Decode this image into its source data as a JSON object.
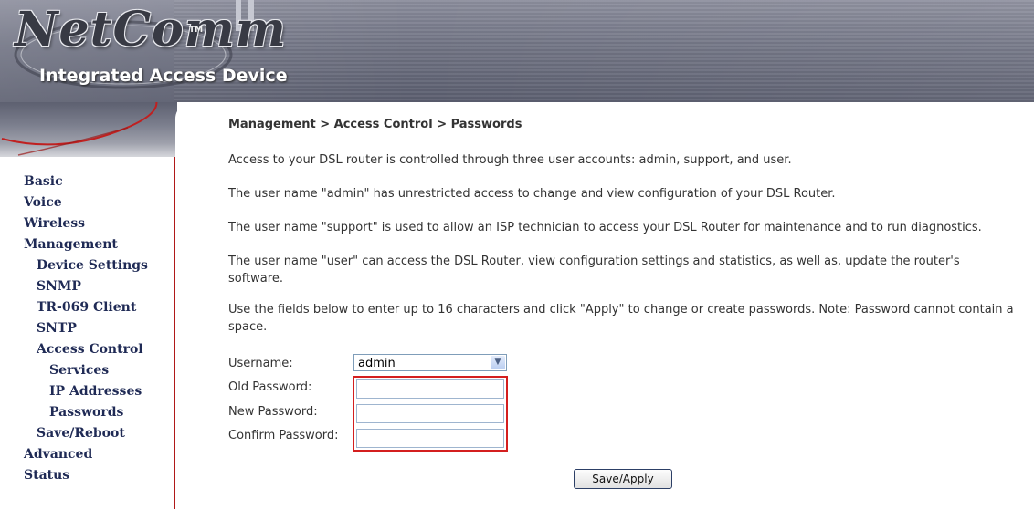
{
  "banner": {
    "logo_text": "NetComm",
    "trademark": "TM",
    "product_name": "Integrated Access Device"
  },
  "nav": [
    {
      "label": "Basic",
      "level": 1
    },
    {
      "label": "Voice",
      "level": 1
    },
    {
      "label": "Wireless",
      "level": 1
    },
    {
      "label": "Management",
      "level": 1
    },
    {
      "label": "Device Settings",
      "level": 2
    },
    {
      "label": "SNMP",
      "level": 2
    },
    {
      "label": "TR-069 Client",
      "level": 2
    },
    {
      "label": "SNTP",
      "level": 2
    },
    {
      "label": "Access Control",
      "level": 2
    },
    {
      "label": "Services",
      "level": 3
    },
    {
      "label": "IP Addresses",
      "level": 3
    },
    {
      "label": "Passwords",
      "level": 3
    },
    {
      "label": "Save/Reboot",
      "level": 2
    },
    {
      "label": "Advanced",
      "level": 1
    },
    {
      "label": "Status",
      "level": 1
    }
  ],
  "main": {
    "breadcrumb": "Management > Access Control > Passwords",
    "paragraphs": [
      "Access to your DSL router is controlled through three user accounts: admin, support, and user.",
      "The user name \"admin\" has unrestricted access to change and view configuration of your DSL Router.",
      "The user name \"support\" is used to allow an ISP technician to access your DSL Router for maintenance and to run diagnostics.",
      "The user name \"user\" can access the DSL Router, view configuration settings and statistics, as well as, update the router's software.",
      "Use the fields below to enter up to 16 characters and click \"Apply\" to change or create passwords. Note: Password cannot contain a space."
    ],
    "form": {
      "username_label": "Username:",
      "username_value": "admin",
      "old_password_label": "Old Password:",
      "new_password_label": "New Password:",
      "confirm_password_label": "Confirm Password:",
      "old_password_value": "",
      "new_password_value": "",
      "confirm_password_value": ""
    },
    "apply_button": "Save/Apply"
  },
  "colors": {
    "nav_text": "#1f2a55",
    "highlight_border": "#d41f1f",
    "sidebar_border": "#b01818"
  }
}
